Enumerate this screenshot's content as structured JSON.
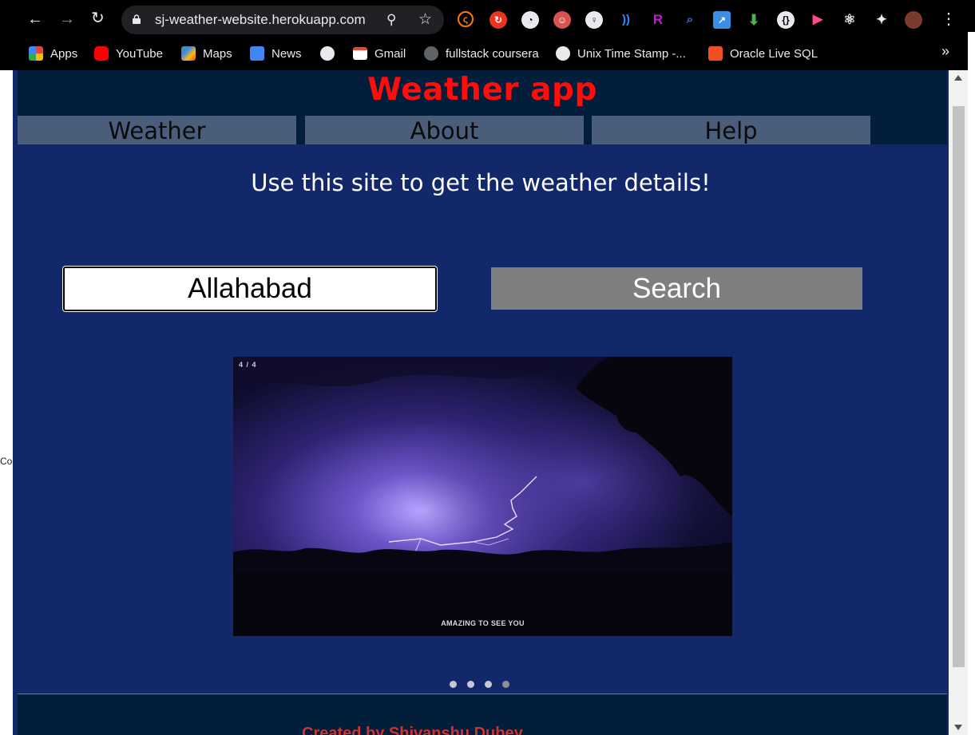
{
  "browser": {
    "url": "sj-weather-website.herokuapp.com",
    "bookmarks": [
      {
        "label": "Apps",
        "icon": "apps-grid-icon",
        "color": "#ea4335"
      },
      {
        "label": "YouTube",
        "icon": "youtube-icon",
        "color": "#ff0000"
      },
      {
        "label": "Maps",
        "icon": "maps-icon",
        "color": "#34a853"
      },
      {
        "label": "News",
        "icon": "google-news-icon",
        "color": "#4285f4"
      },
      {
        "label": "",
        "icon": "globe-icon",
        "color": "#e8eaed"
      },
      {
        "label": "Gmail",
        "icon": "gmail-icon",
        "color": "#ea4335"
      },
      {
        "label": "fullstack coursera",
        "icon": "github-icon",
        "color": "#5f6368"
      },
      {
        "label": "Unix Time Stamp -...",
        "icon": "globe-icon",
        "color": "#e8eaed"
      },
      {
        "label": "Oracle Live SQL",
        "icon": "oracle-icon",
        "color": "#f04e23"
      }
    ],
    "more": "»"
  },
  "page": {
    "title": "Weather app",
    "nav": [
      "Weather",
      "About",
      "Help"
    ],
    "tagline": "Use this site to get the weather details!",
    "search": {
      "value": "Allahabad",
      "button": "Search"
    },
    "carousel": {
      "counter": "4 / 4",
      "caption": "AMAZING TO SEE YOU",
      "slide_count": 4,
      "active_index": 3
    },
    "footer": "Created by Shivanshu Dubey"
  },
  "colors": {
    "page_bg": "#12286b",
    "header_bg": "#021e3a",
    "title": "#ff0d0d",
    "nav_bg": "#4a5d7a",
    "search_btn": "#7f7f7f"
  }
}
